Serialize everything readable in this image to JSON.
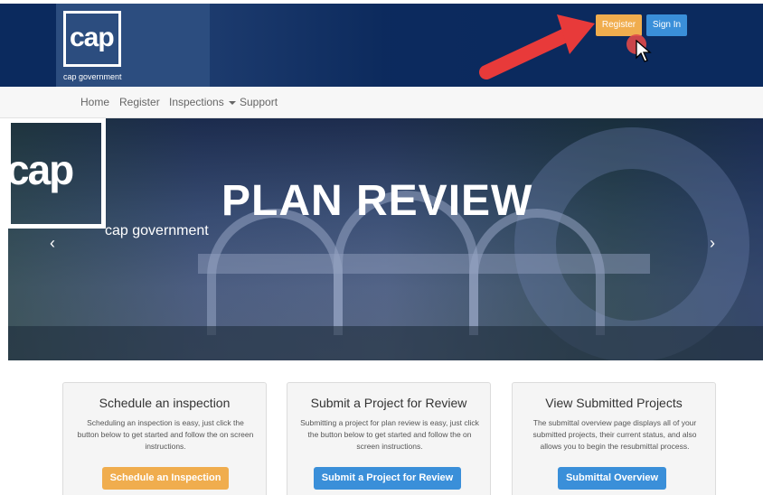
{
  "top_caption": "",
  "header": {
    "logo_text": "cap",
    "logo_subtitle": "cap government",
    "register_label": "Register",
    "signin_label": "Sign In"
  },
  "nav": {
    "items": [
      {
        "label": "Home"
      },
      {
        "label": "Register"
      },
      {
        "label": "Inspections"
      },
      {
        "label": "Support"
      }
    ]
  },
  "hero": {
    "logo_text": "cap",
    "logo_subtitle": "cap government",
    "title": "PLAN REVIEW",
    "prev_label": "‹",
    "next_label": "›"
  },
  "cards": [
    {
      "title": "Schedule an inspection",
      "text": "Scheduling an inspection is easy, just click the button below to get started and follow the on screen instructions.",
      "button": "Schedule an Inspection"
    },
    {
      "title": "Submit a Project for Review",
      "text": "Submitting a project for plan review is easy, just click the button below to get started and follow the on screen instructions.",
      "button": "Submit a Project for Review"
    },
    {
      "title": "View Submitted Projects",
      "text": "The submittal overview page displays all of your submitted projects, their current status, and also allows you to begin the resubmittal process.",
      "button": "Submittal Overview"
    }
  ],
  "colors": {
    "header_bg": "#0b2a5e",
    "register_btn": "#f0ad4e",
    "signin_btn": "#3a8fd9",
    "annotation_arrow": "#e83a3a"
  },
  "icons": {
    "annotation": "red-arrow-icon",
    "cursor": "mouse-cursor-icon",
    "prev": "chevron-left-icon",
    "next": "chevron-right-icon",
    "dropdown": "caret-down-icon"
  }
}
